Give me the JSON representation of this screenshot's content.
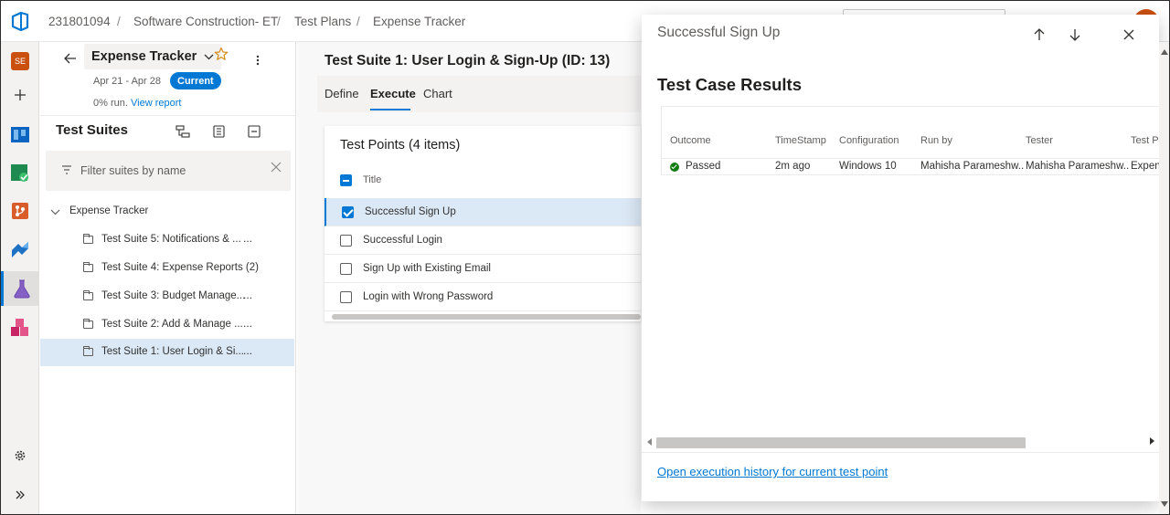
{
  "breadcrumb": {
    "org": "231801094",
    "project": "Software Construction- ET",
    "section": "Test Plans",
    "plan": "Expense Tracker",
    "separator": "/"
  },
  "rail": {
    "project_badge": "SE",
    "items": [
      "new-icon",
      "boards-icon",
      "pipelines-icon",
      "repos-icon",
      "artifacts-icon",
      "test-plans-icon",
      "packages-icon",
      "settings-icon",
      "expand-icon"
    ],
    "active": "test-plans-icon",
    "colors": {
      "accent": "#0078d4",
      "badge": "#ca5010"
    }
  },
  "plan_header": {
    "name": "Expense Tracker",
    "dates": "Apr 21 - Apr 28",
    "badge": "Current",
    "run_percent": "0% run.",
    "view_report": "View report"
  },
  "suites_panel": {
    "title": "Test Suites",
    "filter_placeholder": "Filter suites by name",
    "root": "Expense Tracker",
    "items": [
      {
        "label": "Test Suite 5: Notifications & ...",
        "more": "..."
      },
      {
        "label": "Test Suite 4: Expense Reports (2)",
        "more": ""
      },
      {
        "label": "Test Suite 3: Budget Manage...",
        "more": "..."
      },
      {
        "label": "Test Suite 2: Add & Manage ...",
        "more": "..."
      },
      {
        "label": "Test Suite 1: User Login & Si...",
        "more": "..."
      }
    ],
    "selected_index": 4
  },
  "main": {
    "suite_title": "Test Suite 1: User Login & Sign-Up (ID: 13)",
    "tabs": [
      {
        "label": "Define"
      },
      {
        "label": "Execute"
      },
      {
        "label": "Chart"
      }
    ],
    "active_tab": "Execute",
    "points": {
      "title": "Test Points (4 items)",
      "column": "Title",
      "rows": [
        {
          "label": "Successful Sign Up",
          "checked": true
        },
        {
          "label": "Successful Login",
          "checked": false
        },
        {
          "label": "Sign Up with Existing Email",
          "checked": false
        },
        {
          "label": "Login with Wrong Password",
          "checked": false
        }
      ]
    }
  },
  "dialog": {
    "title": "Successful Sign Up",
    "heading": "Test Case Results",
    "columns": [
      "Outcome",
      "TimeStamp",
      "Configuration",
      "Run by",
      "Tester",
      "Test Pla"
    ],
    "row": {
      "outcome": "Passed",
      "timestamp": "2m ago",
      "configuration": "Windows 10",
      "run_by": "Mahisha Parameshw...",
      "tester": "Mahisha Parameshw...",
      "test_plan": "Expens"
    },
    "history_link": "Open execution history for current test point",
    "status_color": "#107c10"
  }
}
